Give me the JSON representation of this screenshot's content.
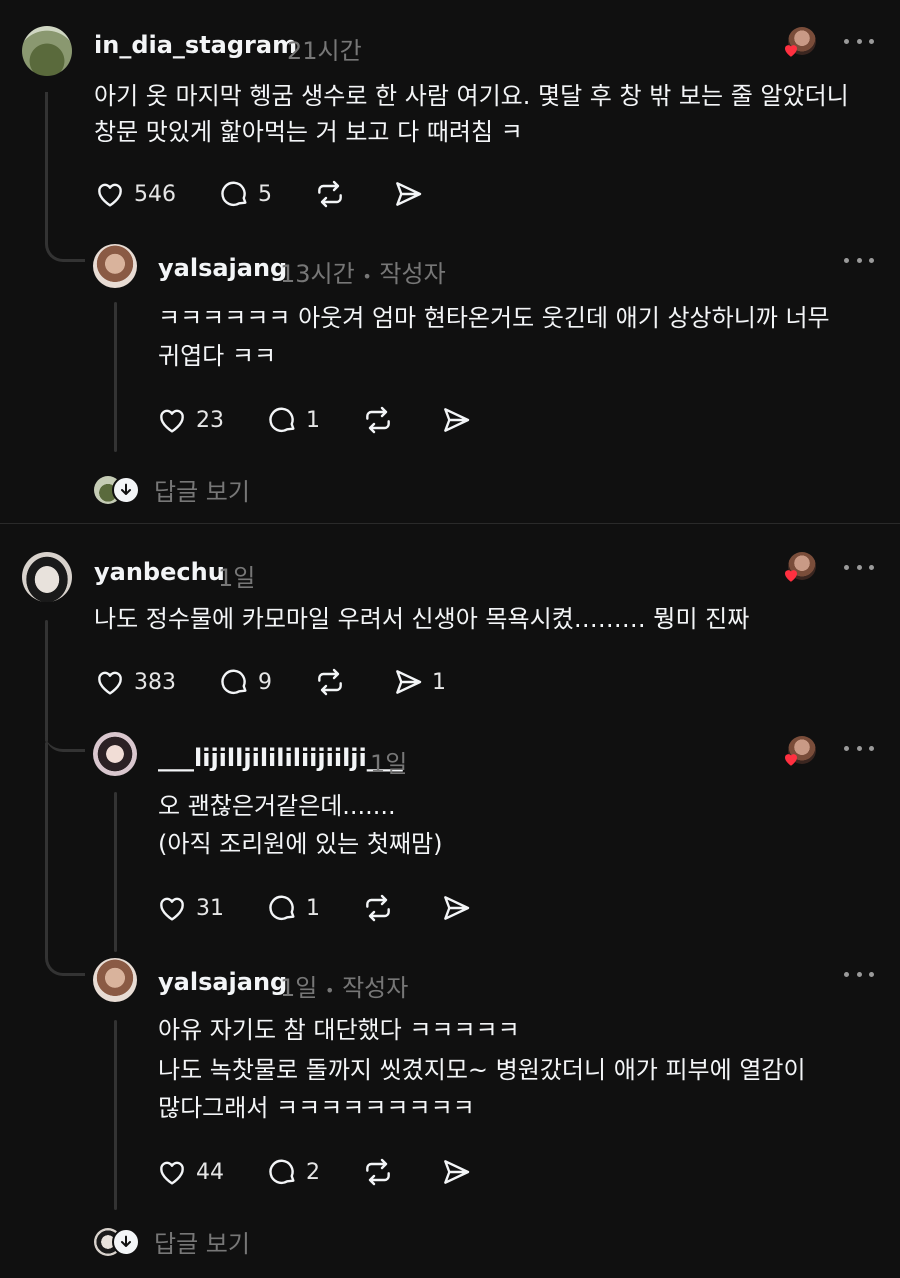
{
  "comments": [
    {
      "username": "in_dia_stagram",
      "time": "21시간",
      "lines": [
        "아기 옷 마지막 헹굼 생수로 한 사람 여기요. 몇달 후 창 밖 보는 줄 알았더니",
        "창문 맛있게 핥아먹는 거 보고 다 때려침 ㅋ"
      ],
      "likes": "546",
      "replies": "5",
      "shares": ""
    },
    {
      "username": "yalsajang",
      "time": "13시간",
      "author_tag": "작성자",
      "lines": [
        "ㅋㅋㅋㅋㅋㅋ 아웃겨 엄마 현타온거도 웃긴데 애기 상상하니까 너무",
        "귀엽다 ㅋㅋ"
      ],
      "likes": "23",
      "replies": "1",
      "shares": ""
    },
    {
      "username": "yanbechu",
      "time": "1일",
      "lines": [
        "나도 정수물에 카모마일 우려서 신생아 목욕시켰……… 뭥미 진짜"
      ],
      "likes": "383",
      "replies": "9",
      "shares": "1"
    },
    {
      "username": "___lijilljilililiijiilji___",
      "time": "1일",
      "lines": [
        "오 괜찮은거같은데.......",
        "(아직 조리원에 있는 첫째맘)"
      ],
      "likes": "31",
      "replies": "1",
      "shares": ""
    },
    {
      "username": "yalsajang",
      "time": "1일",
      "author_tag": "작성자",
      "lines": [
        "아유 자기도 참 대단했다 ㅋㅋㅋㅋㅋ",
        "나도 녹찻물로 돌까지 씻겼지모~ 병원갔더니 애가 피부에 열감이",
        "많다그래서 ㅋㅋㅋㅋㅋㅋㅋㅋㅋ"
      ],
      "likes": "44",
      "replies": "2",
      "shares": ""
    }
  ],
  "view_replies_label": "답글 보기",
  "separator": "•",
  "icons": {
    "more": "more-icon",
    "like": "heart-icon",
    "reply": "comment-icon",
    "repost": "repost-icon",
    "share": "send-icon",
    "liked_by_author": "red-heart-icon",
    "expand": "chevron-down-icon"
  },
  "colors": {
    "background": "#101010",
    "text": "#f3f5f7",
    "secondary": "#777777",
    "heart": "#ff3040"
  }
}
